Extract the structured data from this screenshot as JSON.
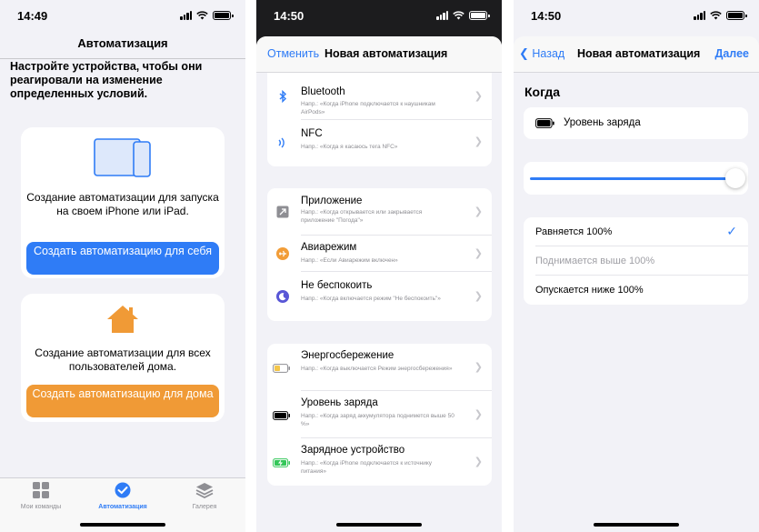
{
  "screen1": {
    "time": "14:49",
    "title": "Автоматизация",
    "intro": "Настройте устройства, чтобы они реагировали на изменение определенных условий.",
    "personal_card": {
      "description": "Создание автоматизации для запуска на своем iPhone или iPad.",
      "button": "Создать автоматизацию для себя",
      "icon": "ipad-iphone-icon"
    },
    "home_card": {
      "description": "Создание автоматизации для всех пользователей дома.",
      "button": "Создать автоматизацию для дома",
      "icon": "home-icon"
    },
    "tabs": [
      {
        "label": "Мои команды",
        "icon": "grid-icon"
      },
      {
        "label": "Автоматизация",
        "icon": "check-circle-icon"
      },
      {
        "label": "Галерея",
        "icon": "layers-icon"
      }
    ]
  },
  "screen2": {
    "time": "14:50",
    "cancel": "Отменить",
    "title": "Новая автоматизация",
    "rows": [
      {
        "title": "Bluetooth",
        "subtitle": "Напр.: «Когда iPhone подключается к наушникам AirPods»",
        "icon": "bluetooth-icon"
      },
      {
        "title": "NFC",
        "subtitle": "Напр.: «Когда я касаюсь тега NFC»",
        "icon": "nfc-icon"
      },
      {
        "title": "Приложение",
        "subtitle": "Напр.: «Когда открывается или закрывается приложение \"Погода\"»",
        "icon": "app-icon"
      },
      {
        "title": "Авиарежим",
        "subtitle": "Напр.: «Если Авиарежим включен»",
        "icon": "airplane-icon"
      },
      {
        "title": "Не беспокоить",
        "subtitle": "Напр.: «Когда включается режим \"Не беспокоить\"»",
        "icon": "moon-icon"
      },
      {
        "title": "Энергосбережение",
        "subtitle": "Напр.: «Когда выключается Режим энергосбережения»",
        "icon": "low-power-battery-icon"
      },
      {
        "title": "Уровень заряда",
        "subtitle": "Напр.: «Когда заряд аккумулятора поднимется выше 50 %»",
        "icon": "battery-level-icon"
      },
      {
        "title": "Зарядное устройство",
        "subtitle": "Напр.: «Когда iPhone подключается к источнику питания»",
        "icon": "charging-battery-icon"
      }
    ]
  },
  "screen3": {
    "time": "14:50",
    "back": "Назад",
    "title": "Новая автоматизация",
    "done": "Далее",
    "section": "Когда",
    "trigger": "Уровень заряда",
    "slider_value": 1.0,
    "options": [
      {
        "label": "Равняется 100%",
        "selected": true,
        "enabled": true
      },
      {
        "label": "Поднимается выше 100%",
        "selected": false,
        "enabled": false
      },
      {
        "label": "Опускается ниже 100%",
        "selected": false,
        "enabled": true
      }
    ]
  },
  "colors": {
    "accent": "#2f7cf6",
    "home_orange": "#f09a36",
    "airplane_orange": "#f29d38",
    "dnd_purple": "#5856d6",
    "charge_green": "#34c759",
    "lowpower_yellow": "#f4c64a"
  }
}
